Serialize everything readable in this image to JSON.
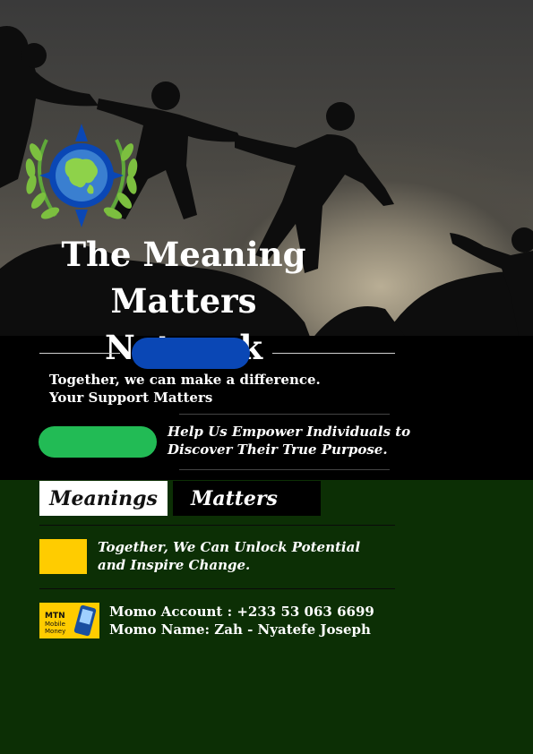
{
  "title": {
    "line1": "The Meaning",
    "line2": "Matters Network"
  },
  "tagline": "Together, we can make a difference. Your Support Matters",
  "mission": "Help Us Empower Individuals to Discover Their True Purpose.",
  "tabs": {
    "left": "Meanings",
    "right": "Matters"
  },
  "unlock": "Together, We Can Unlock Potential and Inspire Change.",
  "momo": {
    "logo_text": [
      "MTN",
      "Mobile",
      "Money"
    ],
    "account": "Momo Account : +233 53 063 6699",
    "name": "Momo Name:  Zah - Nyatefe Joseph"
  },
  "colors": {
    "blue_pill": "#0a47b5",
    "green_pill": "#22bb55",
    "yellow": "#ffcc00",
    "background_green": "#1f5a12"
  },
  "icons": [
    "globe-compass-laurel-logo",
    "mtn-mobile-money-logo"
  ]
}
